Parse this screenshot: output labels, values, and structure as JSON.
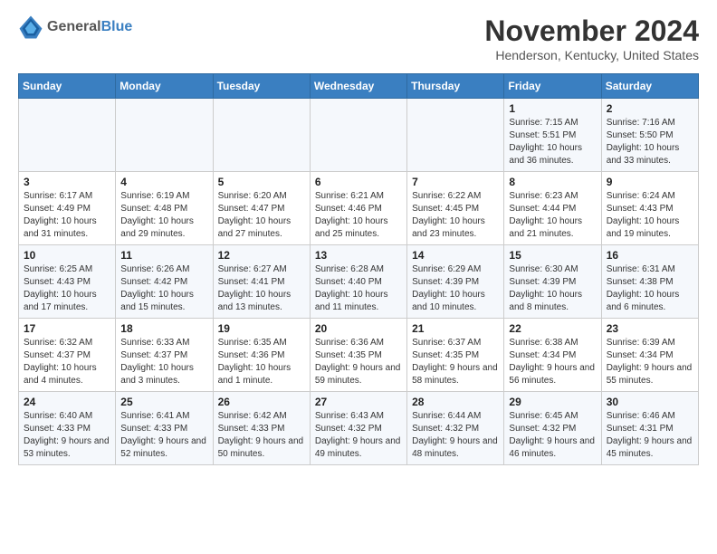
{
  "logo": {
    "text_general": "General",
    "text_blue": "Blue"
  },
  "title": "November 2024",
  "subtitle": "Henderson, Kentucky, United States",
  "days_of_week": [
    "Sunday",
    "Monday",
    "Tuesday",
    "Wednesday",
    "Thursday",
    "Friday",
    "Saturday"
  ],
  "weeks": [
    [
      {
        "day": "",
        "info": ""
      },
      {
        "day": "",
        "info": ""
      },
      {
        "day": "",
        "info": ""
      },
      {
        "day": "",
        "info": ""
      },
      {
        "day": "",
        "info": ""
      },
      {
        "day": "1",
        "info": "Sunrise: 7:15 AM\nSunset: 5:51 PM\nDaylight: 10 hours and 36 minutes."
      },
      {
        "day": "2",
        "info": "Sunrise: 7:16 AM\nSunset: 5:50 PM\nDaylight: 10 hours and 33 minutes."
      }
    ],
    [
      {
        "day": "3",
        "info": "Sunrise: 6:17 AM\nSunset: 4:49 PM\nDaylight: 10 hours and 31 minutes."
      },
      {
        "day": "4",
        "info": "Sunrise: 6:19 AM\nSunset: 4:48 PM\nDaylight: 10 hours and 29 minutes."
      },
      {
        "day": "5",
        "info": "Sunrise: 6:20 AM\nSunset: 4:47 PM\nDaylight: 10 hours and 27 minutes."
      },
      {
        "day": "6",
        "info": "Sunrise: 6:21 AM\nSunset: 4:46 PM\nDaylight: 10 hours and 25 minutes."
      },
      {
        "day": "7",
        "info": "Sunrise: 6:22 AM\nSunset: 4:45 PM\nDaylight: 10 hours and 23 minutes."
      },
      {
        "day": "8",
        "info": "Sunrise: 6:23 AM\nSunset: 4:44 PM\nDaylight: 10 hours and 21 minutes."
      },
      {
        "day": "9",
        "info": "Sunrise: 6:24 AM\nSunset: 4:43 PM\nDaylight: 10 hours and 19 minutes."
      }
    ],
    [
      {
        "day": "10",
        "info": "Sunrise: 6:25 AM\nSunset: 4:43 PM\nDaylight: 10 hours and 17 minutes."
      },
      {
        "day": "11",
        "info": "Sunrise: 6:26 AM\nSunset: 4:42 PM\nDaylight: 10 hours and 15 minutes."
      },
      {
        "day": "12",
        "info": "Sunrise: 6:27 AM\nSunset: 4:41 PM\nDaylight: 10 hours and 13 minutes."
      },
      {
        "day": "13",
        "info": "Sunrise: 6:28 AM\nSunset: 4:40 PM\nDaylight: 10 hours and 11 minutes."
      },
      {
        "day": "14",
        "info": "Sunrise: 6:29 AM\nSunset: 4:39 PM\nDaylight: 10 hours and 10 minutes."
      },
      {
        "day": "15",
        "info": "Sunrise: 6:30 AM\nSunset: 4:39 PM\nDaylight: 10 hours and 8 minutes."
      },
      {
        "day": "16",
        "info": "Sunrise: 6:31 AM\nSunset: 4:38 PM\nDaylight: 10 hours and 6 minutes."
      }
    ],
    [
      {
        "day": "17",
        "info": "Sunrise: 6:32 AM\nSunset: 4:37 PM\nDaylight: 10 hours and 4 minutes."
      },
      {
        "day": "18",
        "info": "Sunrise: 6:33 AM\nSunset: 4:37 PM\nDaylight: 10 hours and 3 minutes."
      },
      {
        "day": "19",
        "info": "Sunrise: 6:35 AM\nSunset: 4:36 PM\nDaylight: 10 hours and 1 minute."
      },
      {
        "day": "20",
        "info": "Sunrise: 6:36 AM\nSunset: 4:35 PM\nDaylight: 9 hours and 59 minutes."
      },
      {
        "day": "21",
        "info": "Sunrise: 6:37 AM\nSunset: 4:35 PM\nDaylight: 9 hours and 58 minutes."
      },
      {
        "day": "22",
        "info": "Sunrise: 6:38 AM\nSunset: 4:34 PM\nDaylight: 9 hours and 56 minutes."
      },
      {
        "day": "23",
        "info": "Sunrise: 6:39 AM\nSunset: 4:34 PM\nDaylight: 9 hours and 55 minutes."
      }
    ],
    [
      {
        "day": "24",
        "info": "Sunrise: 6:40 AM\nSunset: 4:33 PM\nDaylight: 9 hours and 53 minutes."
      },
      {
        "day": "25",
        "info": "Sunrise: 6:41 AM\nSunset: 4:33 PM\nDaylight: 9 hours and 52 minutes."
      },
      {
        "day": "26",
        "info": "Sunrise: 6:42 AM\nSunset: 4:33 PM\nDaylight: 9 hours and 50 minutes."
      },
      {
        "day": "27",
        "info": "Sunrise: 6:43 AM\nSunset: 4:32 PM\nDaylight: 9 hours and 49 minutes."
      },
      {
        "day": "28",
        "info": "Sunrise: 6:44 AM\nSunset: 4:32 PM\nDaylight: 9 hours and 48 minutes."
      },
      {
        "day": "29",
        "info": "Sunrise: 6:45 AM\nSunset: 4:32 PM\nDaylight: 9 hours and 46 minutes."
      },
      {
        "day": "30",
        "info": "Sunrise: 6:46 AM\nSunset: 4:31 PM\nDaylight: 9 hours and 45 minutes."
      }
    ]
  ]
}
